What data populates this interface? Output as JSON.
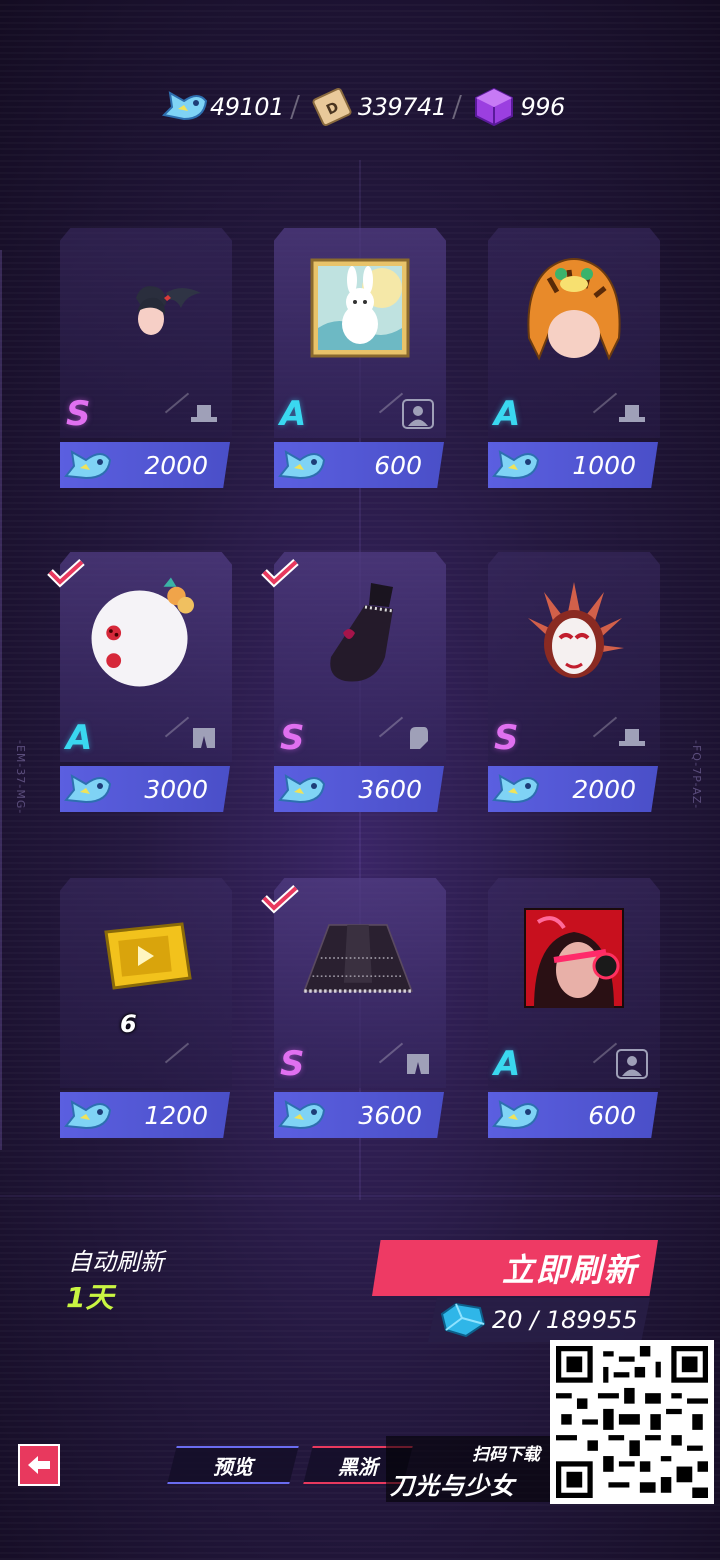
{
  "currencies": [
    {
      "name": "fish-coin",
      "value": "49101"
    },
    {
      "name": "d-ticket",
      "value": "339741"
    },
    {
      "name": "purple-cube",
      "value": "996"
    }
  ],
  "items": [
    {
      "art": "black-ponytail-hair",
      "rank": "S",
      "slot": "hat-icon",
      "price": "2000",
      "owned": false
    },
    {
      "art": "rabbit-portrait-frame",
      "rank": "A",
      "slot": "avatar-icon",
      "price": "600",
      "owned": false
    },
    {
      "art": "tiger-hood-hat",
      "rank": "A",
      "slot": "hat-icon",
      "price": "1000",
      "owned": false
    },
    {
      "art": "white-ball-accessory",
      "rank": "A",
      "slot": "pants-icon",
      "price": "3000",
      "owned": true
    },
    {
      "art": "black-glove",
      "rank": "S",
      "slot": "glove-icon",
      "price": "3600",
      "owned": true
    },
    {
      "art": "feathered-mask-headpiece",
      "rank": "S",
      "slot": "hat-icon",
      "price": "2000",
      "owned": false
    },
    {
      "art": "gold-video-ticket",
      "rank": "",
      "slot": "",
      "price": "1200",
      "owned": false,
      "qty": "6"
    },
    {
      "art": "black-lace-skirt",
      "rank": "S",
      "slot": "pants-icon",
      "price": "3600",
      "owned": true
    },
    {
      "art": "red-character-portrait",
      "rank": "A",
      "slot": "avatar-icon",
      "price": "600",
      "owned": false
    }
  ],
  "refresh": {
    "auto_label": "自动刷新",
    "auto_value": "1天",
    "button_label": "立即刷新",
    "cost": "20 / 189955"
  },
  "nav": {
    "preview": "预览",
    "black": "黑浙"
  },
  "promo": {
    "top": "扫码下载",
    "main": "刀光与少女"
  },
  "side_left": "-EM-37-MG-",
  "side_right": "-FQ-7P-AZ-",
  "colors": {
    "rank_s": "#e070f0",
    "rank_a": "#3ad8f0",
    "price_button": "#5b5fe0",
    "refresh_button": "#ee3a64",
    "auto_value": "#c9f542"
  }
}
